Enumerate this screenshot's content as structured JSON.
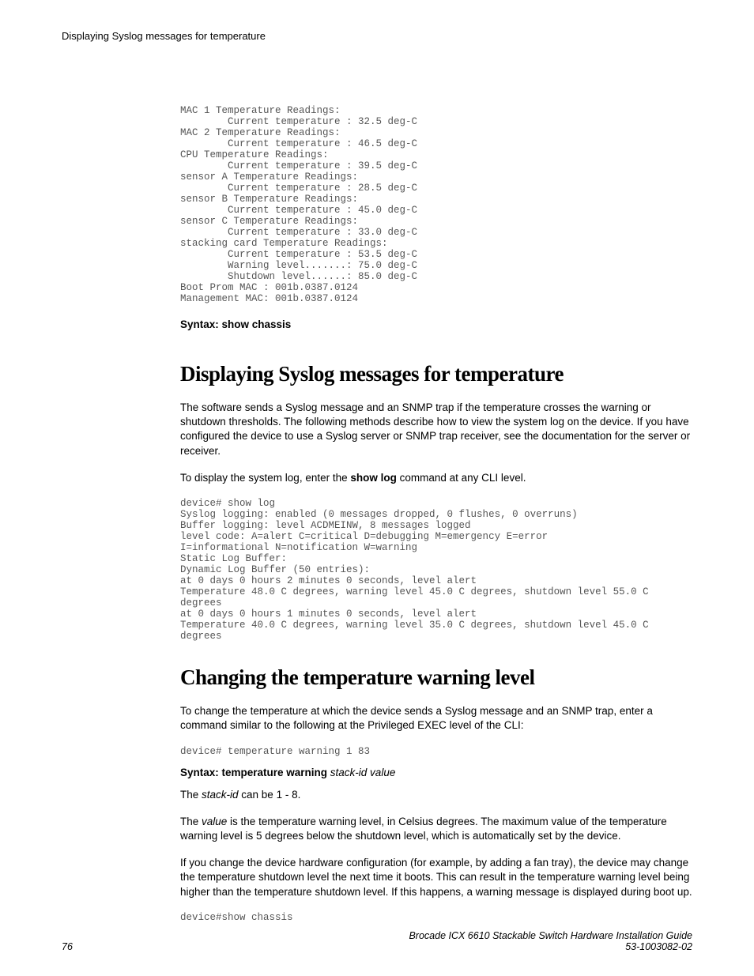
{
  "running_head": "Displaying Syslog messages for temperature",
  "code1": "MAC 1 Temperature Readings:\n        Current temperature : 32.5 deg-C\nMAC 2 Temperature Readings:\n        Current temperature : 46.5 deg-C\nCPU Temperature Readings:\n        Current temperature : 39.5 deg-C\nsensor A Temperature Readings:\n        Current temperature : 28.5 deg-C\nsensor B Temperature Readings:\n        Current temperature : 45.0 deg-C\nsensor C Temperature Readings:\n        Current temperature : 33.0 deg-C\nstacking card Temperature Readings:\n        Current temperature : 53.5 deg-C\n        Warning level.......: 75.0 deg-C\n        Shutdown level......: 85.0 deg-C\nBoot Prom MAC : 001b.0387.0124\nManagement MAC: 001b.0387.0124",
  "syntax1": "Syntax: show chassis",
  "heading1": "Displaying Syslog messages for temperature",
  "para1": "The software sends a Syslog message and an SNMP trap if the temperature crosses the warning or shutdown thresholds. The following methods describe how to view the system log on the device. If you have configured the device to use a Syslog server or SNMP trap receiver, see the documentation for the server or receiver.",
  "para2_pre": "To display the system log, enter the ",
  "para2_bold": "show log",
  "para2_post": " command at any CLI level.",
  "code2": "device# show log\nSyslog logging: enabled (0 messages dropped, 0 flushes, 0 overruns)\nBuffer logging: level ACDMEINW, 8 messages logged\nlevel code: A=alert C=critical D=debugging M=emergency E=error\nI=informational N=notification W=warning\nStatic Log Buffer:\nDynamic Log Buffer (50 entries):\nat 0 days 0 hours 2 minutes 0 seconds, level alert\nTemperature 48.0 C degrees, warning level 45.0 C degrees, shutdown level 55.0 C degrees\nat 0 days 0 hours 1 minutes 0 seconds, level alert\nTemperature 40.0 C degrees, warning level 35.0 C degrees, shutdown level 45.0 C degrees",
  "heading2": "Changing the temperature warning level",
  "para3": "To change the temperature at which the device sends a Syslog message and an SNMP trap, enter a command similar to the following at the Privileged EXEC level of the CLI:",
  "code3": "device# temperature warning 1 83",
  "syntax2_bold": "Syntax: temperature warning",
  "syntax2_em": " stack-id value",
  "para4_pre": "The ",
  "para4_em": "stack-id",
  "para4_post": " can be 1 - 8.",
  "para5_pre": "The ",
  "para5_em": "value",
  "para5_post": " is the temperature warning level, in Celsius degrees. The maximum value of the temperature warning level is 5 degrees below the shutdown level, which is automatically set by the device.",
  "para6": "If you change the device hardware configuration (for example, by adding a fan tray), the device may change the temperature shutdown level the next time it boots. This can result in the temperature warning level being higher than the temperature shutdown level. If this happens, a warning message is displayed during boot up.",
  "code4": "device#show chassis",
  "footer_page": "76",
  "footer_title": "Brocade ICX 6610 Stackable Switch Hardware Installation Guide",
  "footer_doc": "53-1003082-02"
}
